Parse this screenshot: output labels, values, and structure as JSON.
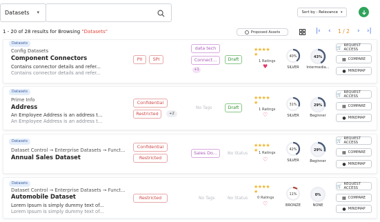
{
  "toolbar": {
    "category_label": "Datasets",
    "search_placeholder": "",
    "sort_label": "Sort by : Relevance"
  },
  "results": {
    "prefix": "1 - 20 of 28 results for Browsing ",
    "query": "\"Datasets\"",
    "proposed_label": "Proposed Assets",
    "page_text": "1 / 2"
  },
  "actions": {
    "request": "REQUEST ACCESS",
    "compare": "COMPARE",
    "mindmap": "MINDMAP"
  },
  "colors": {
    "accent_blue": "#3c6df0",
    "query_red": "#e2463b",
    "draft_green": "#2e8f2e",
    "floating_green": "#2fa35a"
  },
  "cards": [
    {
      "badge": "Datasets",
      "crumb": "Config Datasets",
      "title": "Component Connectors",
      "desc1": "Contains connector details and refer...",
      "desc2": "Contains connector details and refer...",
      "tags": [
        "PII",
        "SPI"
      ],
      "tag_more": "",
      "labels": [
        "data tech",
        "Connect..."
      ],
      "label_more": "+1",
      "status": "Draft",
      "rating_text": "1 Ratings",
      "heart_filled": true,
      "ring1": {
        "value": "40%",
        "label": "SILVER",
        "pct": 40
      },
      "ring2": {
        "value": "43%",
        "label": "Intermedia...",
        "pct": 43
      }
    },
    {
      "badge": "Datasets",
      "crumb": "Prime Info",
      "title": "Address",
      "desc1": "An Employee Address is an address t...",
      "desc2": "An Employee Address is an address t...",
      "tags": [
        "Confidential",
        "Restricted"
      ],
      "tag_more": "+2",
      "labels_empty": "No Tags",
      "status": "Draft",
      "rating_text": "1 Ratings",
      "heart_filled": false,
      "ring1": {
        "value": "31%",
        "label": "SILVER",
        "pct": 31
      },
      "ring2": {
        "value": "29%",
        "label": "Beginner",
        "pct": 29
      }
    },
    {
      "badge": "Datasets",
      "crumb": "Dataset Control → Enterprise Datasets → Funct...",
      "title": "Annual Sales Dataset",
      "tags": [
        "Confidential",
        "Restricted"
      ],
      "labels": [
        "Sales Do..."
      ],
      "status_empty": "No Status",
      "rating_text": "1 Ratings",
      "heart_filled": false,
      "ring1": {
        "value": "42%",
        "label": "SILVER",
        "pct": 42
      },
      "ring2": {
        "value": "29%",
        "label": "Beginner",
        "pct": 29
      }
    },
    {
      "badge": "Datasets",
      "crumb": "Dataset Control → Enterprise Datasets → Funct...",
      "title": "Automobile Dataset",
      "desc1": "Lorem Ipsum is simply dummy text of...",
      "desc2": "Lorem Ipsum is simply dummy text of...",
      "tags": [
        "Restricted"
      ],
      "labels_empty": "No Tags",
      "status_empty": "No Status",
      "rating_text": "0 Ratings",
      "heart_filled": false,
      "ring1": {
        "value": "11%",
        "label": "BRONZE",
        "pct": 11
      },
      "ring2": {
        "value": "0%",
        "label": "NONE",
        "pct": 0
      }
    }
  ]
}
